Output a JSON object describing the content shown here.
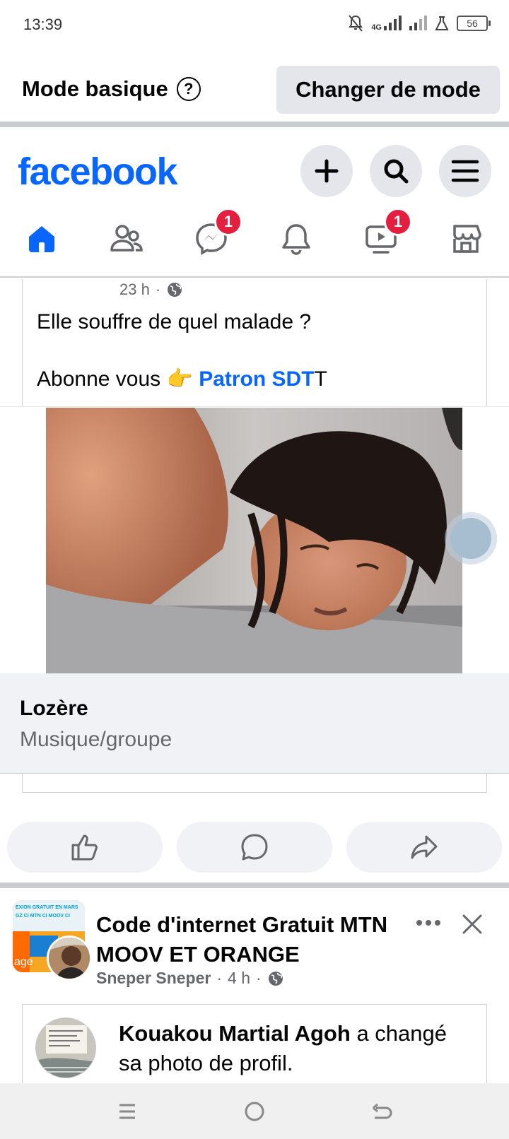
{
  "status_bar": {
    "time": "13:39",
    "network": "4G",
    "battery": "56"
  },
  "mode_bar": {
    "label": "Mode basique",
    "help": "?",
    "button": "Changer de mode"
  },
  "header": {
    "logo": "facebook",
    "actions": [
      "plus-icon",
      "search-icon",
      "menu-icon"
    ],
    "nav": [
      {
        "name": "home",
        "icon": "home-icon",
        "active": true
      },
      {
        "name": "friends",
        "icon": "friends-icon"
      },
      {
        "name": "messenger",
        "icon": "messenger-icon",
        "badge": "1"
      },
      {
        "name": "notifications",
        "icon": "bell-icon"
      },
      {
        "name": "video",
        "icon": "video-icon",
        "badge": "1"
      },
      {
        "name": "marketplace",
        "icon": "marketplace-icon"
      }
    ],
    "accent": "#0866ff",
    "badge_color": "#e41e3f"
  },
  "post": {
    "time": "23 h",
    "line1": "Elle souffre de quel malade ?",
    "line2_prefix": "Abonne vous",
    "line2_emoji": "👉",
    "mention": "Patron SDT",
    "line2_suffix": "T",
    "page_name": "Lozère",
    "page_category": "Musique/groupe"
  },
  "actions": [
    "like-icon",
    "comment-icon",
    "share-icon"
  ],
  "post2": {
    "title": "Code d'internet Gratuit MTN MOOV ET ORANGE",
    "author": "Sneper Sneper",
    "time": "4 h",
    "avatar_text_top": "EXION GRATUIT EN MARS",
    "avatar_text_mid": "GZ CI MTN CI MOOV CI",
    "avatar_text_bottom": "age",
    "shared_name": "Kouakou Martial Agoh",
    "shared_action": "a changé sa photo de profil."
  }
}
